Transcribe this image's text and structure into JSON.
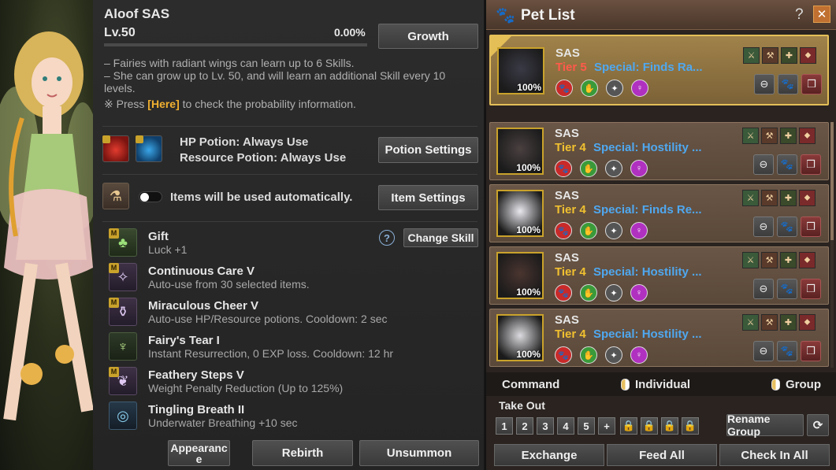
{
  "fairy": {
    "name": "Aloof SAS",
    "level": "Lv.50",
    "progress_percent": "0.00%",
    "progress_value": 0,
    "growth_button": "Growth",
    "info_lines": [
      "– Fairies with radiant wings can learn up to 6 Skills.",
      "– She can grow up to Lv. 50, and will learn an additional Skill every 10",
      "levels."
    ],
    "probability_prefix": "※ Press ",
    "probability_link": "[Here]",
    "probability_suffix": " to check the probability information.",
    "hp_potion": "HP Potion: Always Use",
    "resource_potion": "Resource Potion: Always Use",
    "potion_settings_button": "Potion Settings",
    "items_auto_text": "Items will be used automatically.",
    "item_settings_button": "Item Settings",
    "change_skill_button": "Change Skill",
    "skills": [
      {
        "name": "Gift",
        "desc": "Luck +1",
        "icon": "clover-icon",
        "mastered": true
      },
      {
        "name": "Continuous Care V",
        "desc": "Auto-use from 30 selected items.",
        "icon": "fairy-icon",
        "mastered": true
      },
      {
        "name": "Miraculous Cheer V",
        "desc": "Auto-use HP/Resource potions. Cooldown: 2 sec",
        "icon": "potion-icon",
        "mastered": true
      },
      {
        "name": "Fairy's Tear I",
        "desc": "Instant Resurrection, 0 EXP loss. Cooldown: 12 hr",
        "icon": "tear-icon",
        "mastered": false
      },
      {
        "name": "Feathery Steps V",
        "desc": "Weight Penalty Reduction (Up to 125%)",
        "icon": "feather-icon",
        "mastered": true
      },
      {
        "name": "Tingling Breath II",
        "desc": "Underwater Breathing +10 sec",
        "icon": "bubble-icon",
        "mastered": false
      }
    ],
    "appearance_button": "Appearanc e",
    "rebirth_button": "Rebirth",
    "unsummon_button": "Unsummon"
  },
  "pet_list": {
    "title": "Pet List",
    "help_label": "?",
    "pets": [
      {
        "name": "SAS",
        "tier": "Tier 5",
        "tier_color": "#ff5a4a",
        "special": "Special: Finds Ra...",
        "percent": "100%",
        "selected": true,
        "portrait_color": "#3a3a46"
      },
      {
        "name": "SAS",
        "tier": "Tier 4",
        "tier_color": "#f0c030",
        "special": "Special: Hostility ...",
        "percent": "100%",
        "selected": false,
        "portrait_color": "#4a4040"
      },
      {
        "name": "SAS",
        "tier": "Tier 4",
        "tier_color": "#f0c030",
        "special": "Special: Finds Re...",
        "percent": "100%",
        "selected": false,
        "portrait_color": "#e8e8ee"
      },
      {
        "name": "SAS",
        "tier": "Tier 4",
        "tier_color": "#f0c030",
        "special": "Special: Hostility ...",
        "percent": "100%",
        "selected": false,
        "portrait_color": "#4a3530"
      },
      {
        "name": "SAS",
        "tier": "Tier 4",
        "tier_color": "#f0c030",
        "special": "Special: Hostility ...",
        "percent": "100%",
        "selected": false,
        "portrait_color": "#dcdce0"
      }
    ],
    "command_label": "Command",
    "individual_label": "Individual",
    "group_label": "Group",
    "take_out_label": "Take Out",
    "take_out_slots": [
      "1",
      "2",
      "3",
      "4",
      "5"
    ],
    "rename_group_button": "Rename Group",
    "exchange_tab": "Exchange",
    "feed_all_tab": "Feed All",
    "check_in_all_tab": "Check In All"
  }
}
